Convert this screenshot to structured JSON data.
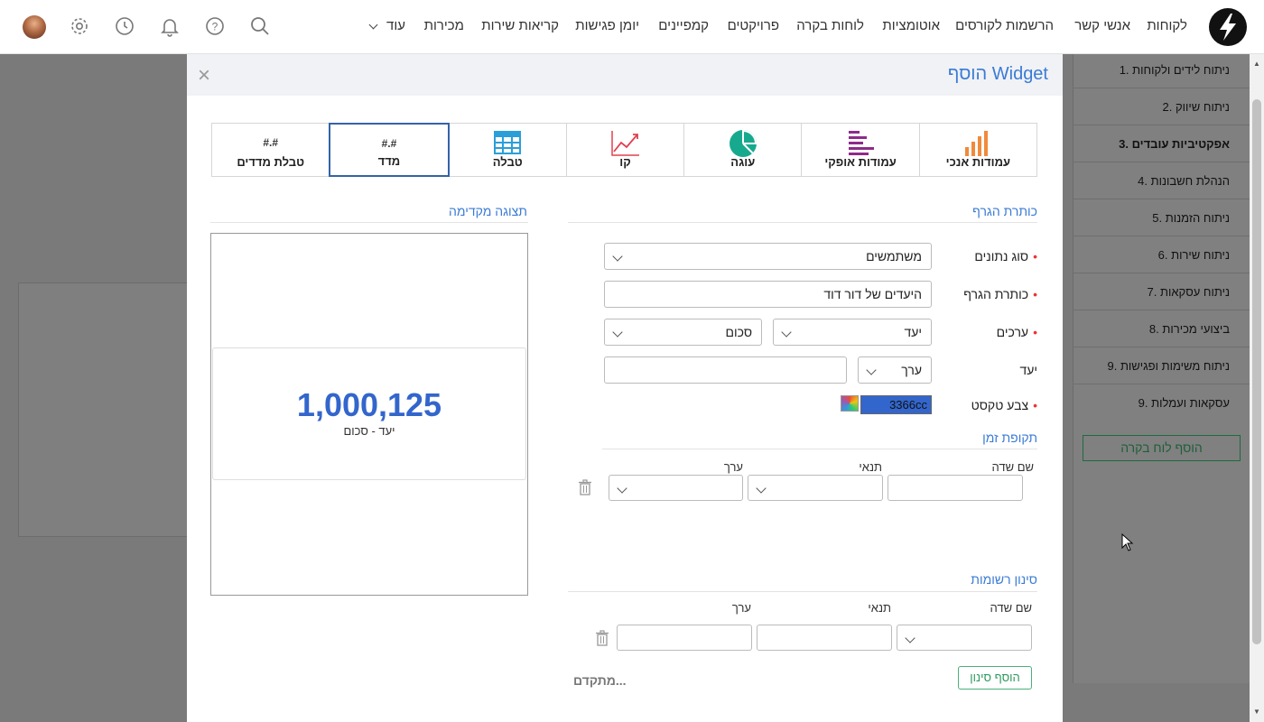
{
  "topnav": {
    "items": [
      "לקוחות",
      "אנשי קשר",
      "הרשמות לקורסים",
      "אוטומציות",
      "לוחות בקרה",
      "פרויקטים",
      "קמפיינים",
      "יומן פגישות",
      "קריאות שירות",
      "מכירות"
    ],
    "more_label": "עוד"
  },
  "sidebar": {
    "items": [
      "1. ניתוח לידים ולקוחות",
      "2. ניתוח שיווק",
      "3. אפקטיביות עובדים",
      "4. הנהלת חשבונות",
      "5. ניתוח הזמנות",
      "6. ניתוח שירות",
      "7. ניתוח עסקאות",
      "8. ביצועי מכירות",
      "9. ניתוח משימות ופגישות",
      "9. עסקאות ועמלות"
    ],
    "active_index": 2,
    "add_board_label": "הוסף לוח בקרה"
  },
  "modal": {
    "title": "הוסף Widget",
    "close_symbol": "×",
    "tabs": [
      {
        "label": "עמודות אנכי",
        "icon": "vertical-bars-icon"
      },
      {
        "label": "עמודות אופקי",
        "icon": "horizontal-bars-icon"
      },
      {
        "label": "עוגה",
        "icon": "pie-chart-icon"
      },
      {
        "label": "קו",
        "icon": "line-chart-icon"
      },
      {
        "label": "טבלה",
        "icon": "table-icon"
      },
      {
        "label": "מדד",
        "icon": "hash-text",
        "hash": "#.#"
      },
      {
        "label": "טבלת מדדים",
        "icon": "hash-text",
        "hash": "#.#"
      }
    ],
    "selected_tab": 5,
    "form": {
      "section_title": "כותרת הגרף",
      "data_type_label": "סוג נתונים",
      "data_type_value": "משתמשים",
      "chart_title_label": "כותרת הגרף",
      "chart_title_value": "היעדים של דור דוד",
      "values_label": "ערכים",
      "values_field": "יעד",
      "values_agg": "סכום",
      "target_label": "יעד",
      "target_type": "ערך",
      "target_value": "",
      "text_color_label": "צבע טקסט",
      "text_color_value": "3366cc",
      "req_mark": "•"
    },
    "time_period": {
      "title": "תקופת זמן",
      "col_field": "שם שדה",
      "col_condition": "תנאי",
      "col_value": "ערך"
    },
    "filter": {
      "title": "סינון רשומות",
      "col_field": "שם שדה",
      "col_condition": "תנאי",
      "col_value": "ערך",
      "add_filter_label": "הוסף סינון",
      "advanced_label": "מתקדם..."
    },
    "preview": {
      "title": "תצוגה מקדימה",
      "value": "1,000,125",
      "subtitle": "יעד - סכום"
    }
  },
  "colors": {
    "accent": "#3a7bd5",
    "metric": "#3366cc",
    "selected_border": "#3463a6",
    "add_green": "#2e9a5e"
  }
}
